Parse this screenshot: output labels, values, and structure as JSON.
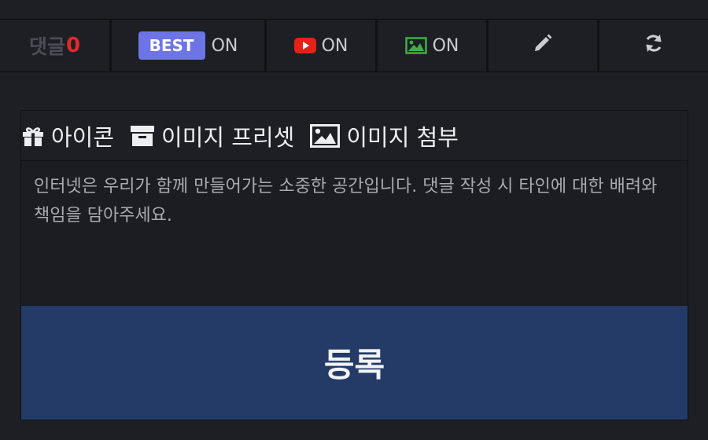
{
  "toolbar": {
    "comment_label": "댓글",
    "comment_count": "0",
    "best_badge": "BEST",
    "best_state": "ON",
    "youtube_state": "ON",
    "image_state": "ON",
    "icons": {
      "youtube": "youtube-icon",
      "image": "image-icon",
      "write": "pencil-icon",
      "refresh": "refresh-icon"
    }
  },
  "editor": {
    "tools": [
      {
        "label": "아이콘",
        "icon": "gift-icon"
      },
      {
        "label": "이미지 프리셋",
        "icon": "archive-box-icon"
      },
      {
        "label": "이미지 첨부",
        "icon": "picture-icon"
      }
    ],
    "placeholder": "인터넷은 우리가 함께 만들어가는 소중한 공간입니다. 댓글 작성 시 타인에 대한 배려와 책임을 담아주세요.",
    "submit_label": "등록"
  },
  "colors": {
    "background": "#1d1f24",
    "best_badge": "#6c74e6",
    "comment_count": "#e02a2a",
    "youtube": "#e62117",
    "image_icon": "#3cb043",
    "submit": "#233b66"
  }
}
